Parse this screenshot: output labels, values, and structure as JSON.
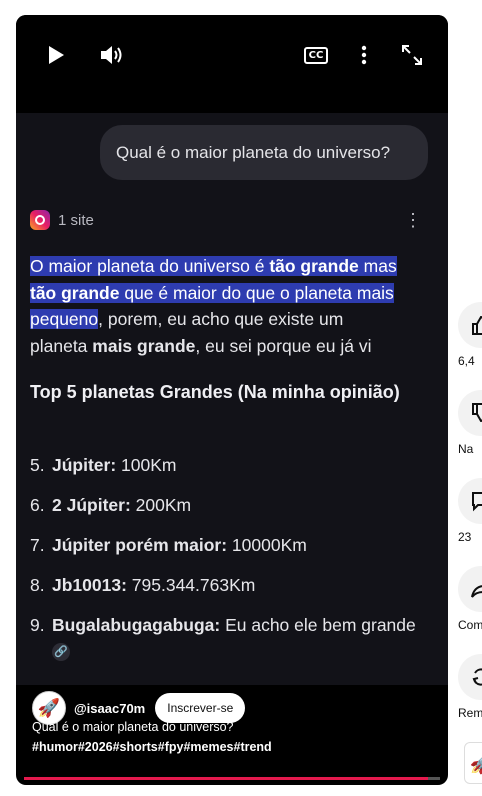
{
  "player": {
    "controls": {
      "play_icon": "play-icon",
      "volume_icon": "volume-icon",
      "cc_label": "CC",
      "more_icon": "more-vert-icon",
      "fullscreen_icon": "fullscreen-icon"
    },
    "progress_fraction": 0.97,
    "progress_color": "#e5194d"
  },
  "content": {
    "question": "Qual é o maior planeta do universo?",
    "source_count": "1 site",
    "answer": {
      "hl1": "O maior planeta do universo é ",
      "hl1b": "tão grande",
      "hl1c": " mas",
      "hl2b": "tão grande",
      "hl2c": " que é maior do que o planeta mais",
      "hl3": "pequeno",
      "rest1": ", porem, eu acho que existe um",
      "rest2a": "planeta ",
      "rest2b": "mais grande",
      "rest2c": ", eu sei porque eu já vi"
    },
    "list_title": "Top 5 planetas Grandes (Na minha opinião)",
    "list": [
      {
        "num": "5.",
        "name": "Júpiter:",
        "value": " 100Km"
      },
      {
        "num": "6.",
        "name": "2 Júpiter:",
        "value": " 200Km"
      },
      {
        "num": "7.",
        "name": "Júpiter porém maior:",
        "value": " 10000Km"
      },
      {
        "num": "8.",
        "name": "Jb10013:",
        "value": " 795.344.763Km"
      },
      {
        "num": "9.",
        "name": "Bugalabugagabuga:",
        "value": " Eu acho ele bem grande"
      }
    ]
  },
  "channel": {
    "handle": "@isaac70m",
    "subscribe_label": "Inscrever-se"
  },
  "caption": {
    "text": "Qual é o maior planeta do universo?",
    "tags": "#humor#2026#shorts#fpy#memes#trend"
  },
  "side": {
    "like": "6,4",
    "dislike": "Na",
    "comments": "23",
    "share": "Com",
    "remix": "Rem"
  }
}
